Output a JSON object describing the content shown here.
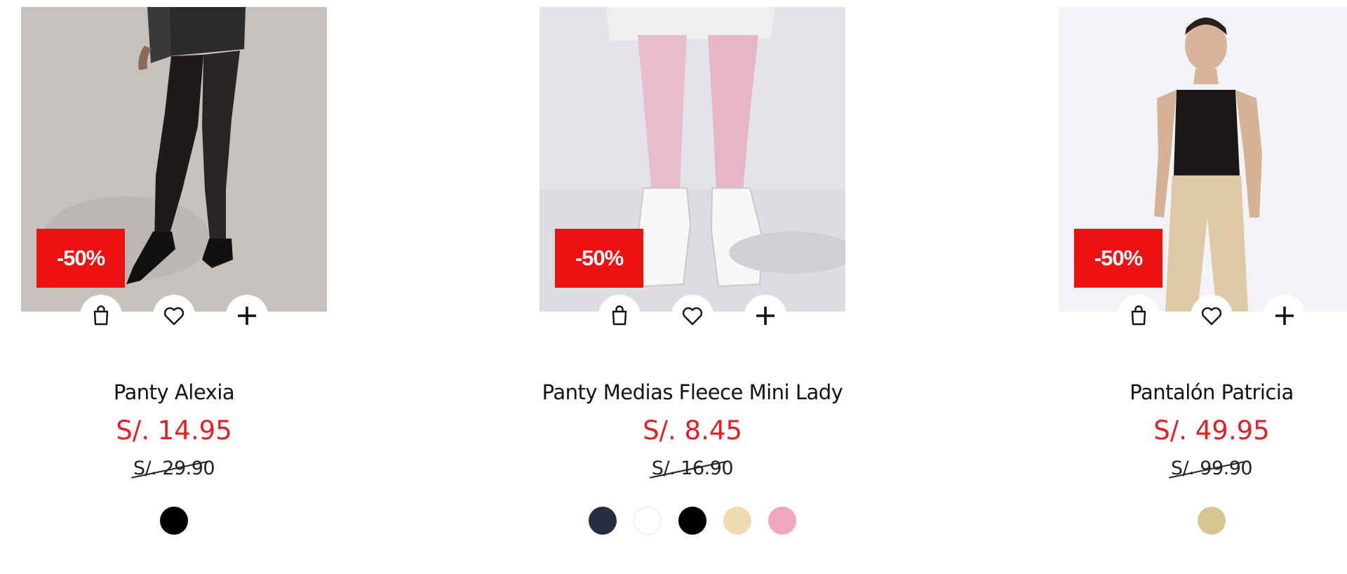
{
  "products": [
    {
      "name": "Panty Alexia",
      "discount": "-50%",
      "price": "S/. 14.95",
      "old_price": "S/. 29.90",
      "colors": [
        "#000000"
      ]
    },
    {
      "name": "Panty Medias Fleece Mini Lady",
      "discount": "-50%",
      "price": "S/. 8.45",
      "old_price": "S/. 16.90",
      "colors": [
        "#272d3f",
        "#ffffff",
        "#000000",
        "#eddcb3",
        "#f0a6bf"
      ]
    },
    {
      "name": "Pantalón Patricia",
      "discount": "-50%",
      "price": "S/. 49.95",
      "old_price": "S/. 99.90",
      "colors": [
        "#d9c594"
      ]
    }
  ],
  "icons": {
    "bag": "shopping-bag-icon",
    "fav": "heart-icon",
    "add": "plus-icon"
  },
  "colors": {
    "badge": "#ee1111",
    "price": "#e21f26"
  }
}
